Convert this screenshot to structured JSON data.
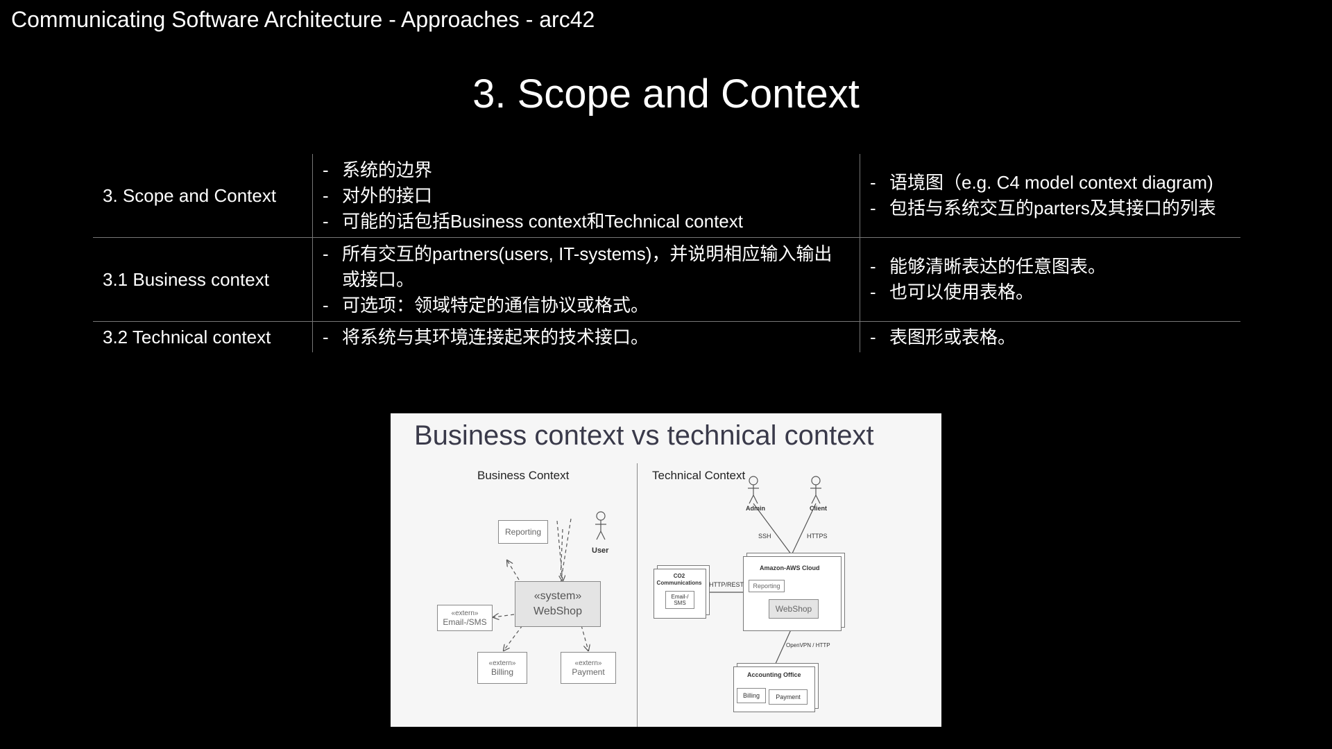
{
  "deck_title": "Communicating Software Architecture - Approaches - arc42",
  "slide_title": "3. Scope and Context",
  "table": [
    {
      "section": "3. Scope and Context",
      "content": [
        "系统的边界",
        "对外的接口",
        "可能的话包括Business context和Technical context"
      ],
      "notation": [
        "语境图（e.g. C4 model context diagram)",
        "包括与系统交互的parters及其接口的列表"
      ]
    },
    {
      "section": "3.1 Business context",
      "content": [
        "所有交互的partners(users, IT-systems)，并说明相应输入输出或接口。",
        "可选项：领域特定的通信协议或格式。"
      ],
      "notation": [
        "能够清晰表达的任意图表。",
        "也可以使用表格。"
      ]
    },
    {
      "section": "3.2 Technical context",
      "content": [
        "将系统与其环境连接起来的技术接口。"
      ],
      "notation": [
        "表图形或表格。"
      ]
    }
  ],
  "figure": {
    "title": "Business context vs technical context",
    "business": {
      "label": "Business Context",
      "reporting": "Reporting",
      "user": "User",
      "system_stereo": "«system»",
      "system_name": "WebShop",
      "email_stereo": "«extern»",
      "email": "Email-/SMS",
      "billing_stereo": "«extern»",
      "billing": "Billing",
      "payment_stereo": "«extern»",
      "payment": "Payment"
    },
    "technical": {
      "label": "Technical Context",
      "admin": "Admin",
      "client": "Client",
      "ssh": "SSH",
      "https": "HTTPS",
      "cloud": "Amazon-AWS Cloud",
      "reporting": "Reporting",
      "webshop": "WebShop",
      "co2": "CO2 Communications",
      "email": "Email-/ SMS",
      "http_rest": "HTTP/REST",
      "openvpn": "OpenVPN / HTTP",
      "accounting": "Accounting Office",
      "billing": "Billing",
      "payment": "Payment"
    }
  }
}
